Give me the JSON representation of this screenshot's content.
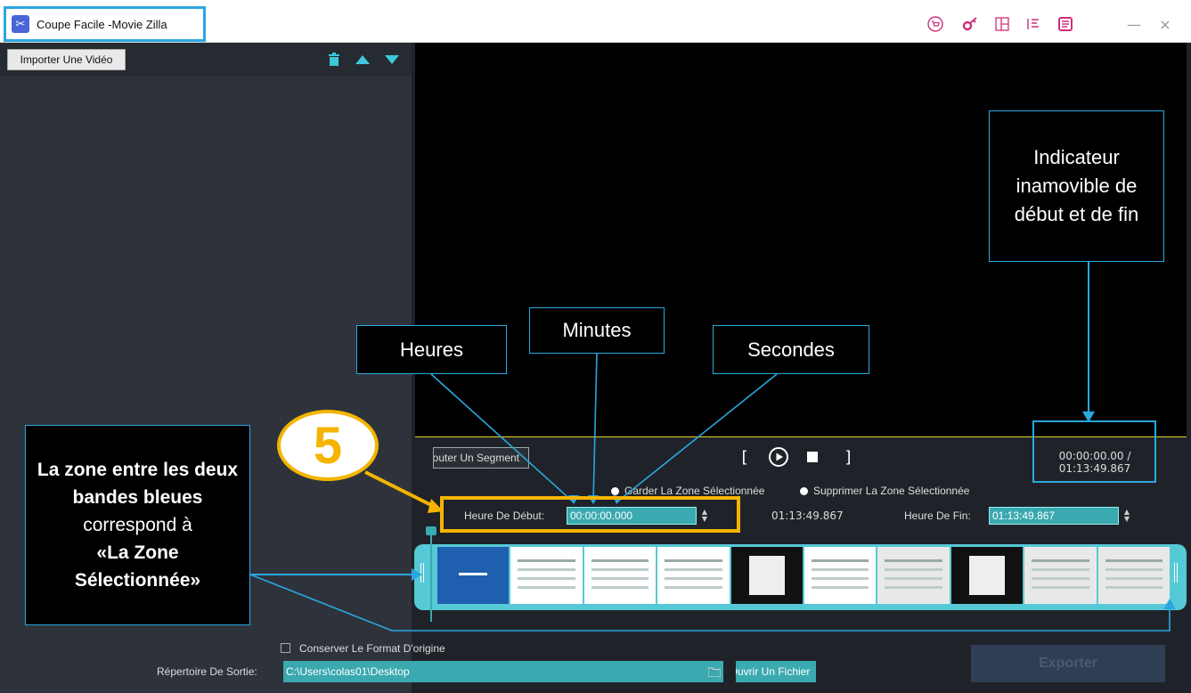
{
  "window": {
    "title": "Coupe Facile -Movie Zilla",
    "logo_icon": "scissors-icon",
    "toolbar_icons": [
      "cart-icon",
      "key-icon",
      "layout-icon",
      "list-icon",
      "menu-icon"
    ],
    "minimize_glyph": "—",
    "close_glyph": "×",
    "accent_color": "#ce2f7a"
  },
  "left_panel": {
    "import_label": "Importer Une Vidéo",
    "icons": [
      "trash-icon",
      "move-up-icon",
      "move-down-icon"
    ]
  },
  "controls": {
    "add_segment_label": "Ajouter Un Segment",
    "playback_icons": [
      "mark-in-icon",
      "play-icon",
      "stop-icon",
      "mark-out-icon"
    ],
    "time_current": "00:00:00.00 /",
    "time_total": "01:13:49.867",
    "radio_keep": "Garder La Zone Sélectionnée",
    "radio_delete": "Supprimer La Zone Sélectionnée",
    "start_label": "Heure De Début:",
    "start_value": "00:00:00.000",
    "duration": "01:13:49.867",
    "end_label": "Heure De Fin:",
    "end_value": "01:13:49.867"
  },
  "bottom": {
    "keep_format_label": "Conserver Le Format D'origine",
    "outdir_label": "Répertoire De Sortie:",
    "outdir_value": "C:\\Users\\colas01\\Desktop",
    "open_file_label": "Ouvrir Un Fichier",
    "export_label": "Exporter"
  },
  "annotations": {
    "heures": "Heures",
    "minutes": "Minutes",
    "secondes": "Secondes",
    "indicateur": "Indicateur inamovible de début et de fin",
    "step_number": "5",
    "zone_line1": "La zone entre les deux bandes bleues",
    "zone_line2": "correspond à",
    "zone_line3": "«La Zone Sélectionnée»"
  }
}
